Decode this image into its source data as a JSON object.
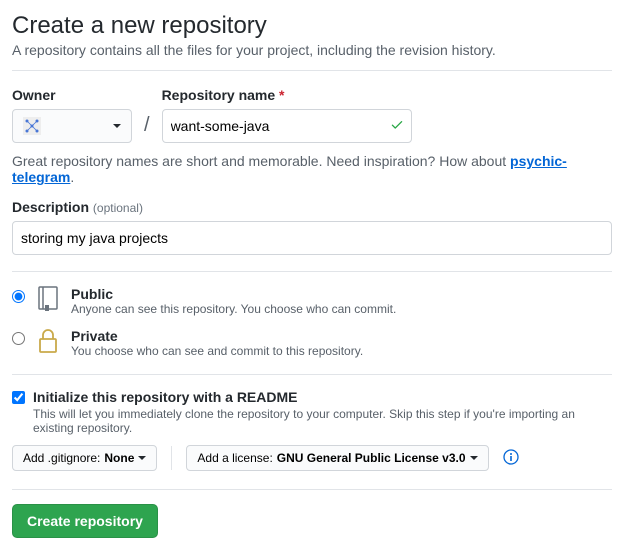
{
  "header": {
    "title": "Create a new repository",
    "subtitle": "A repository contains all the files for your project, including the revision history."
  },
  "owner": {
    "label": "Owner"
  },
  "repo": {
    "label": "Repository name",
    "value": "want-some-java"
  },
  "hint": {
    "text_prefix": "Great repository names are short and memorable. Need inspiration? How about ",
    "suggestion": "psychic-telegram",
    "text_suffix": "."
  },
  "description": {
    "label": "Description",
    "optional": "(optional)",
    "value": "storing my java projects"
  },
  "visibility": {
    "public": {
      "title": "Public",
      "desc": "Anyone can see this repository. You choose who can commit."
    },
    "private": {
      "title": "Private",
      "desc": "You choose who can see and commit to this repository."
    }
  },
  "initialize": {
    "title": "Initialize this repository with a README",
    "desc": "This will let you immediately clone the repository to your computer. Skip this step if you're importing an existing repository."
  },
  "gitignore": {
    "prefix": "Add .gitignore: ",
    "value": "None"
  },
  "license": {
    "prefix": "Add a license: ",
    "value": "GNU General Public License v3.0"
  },
  "submit": {
    "label": "Create repository"
  }
}
